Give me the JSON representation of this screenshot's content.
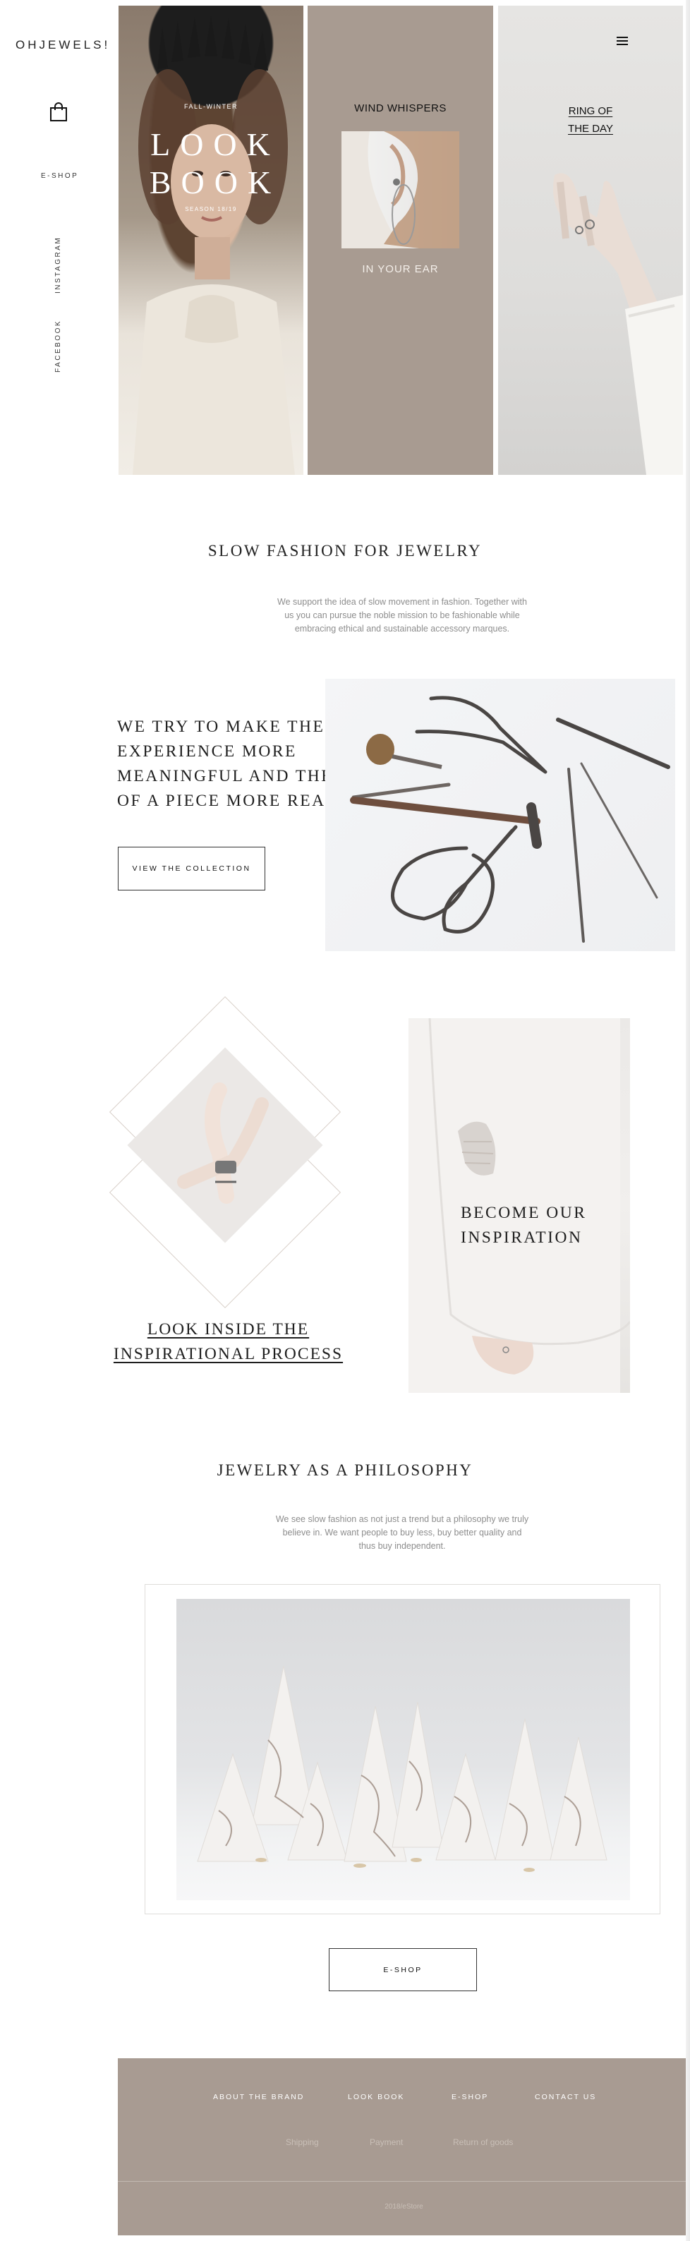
{
  "brand": {
    "logo": "OHJEWELS!"
  },
  "rail": {
    "shop": "E-SHOP",
    "instagram": "INSTAGRAM",
    "facebook": "FACEBOOK"
  },
  "hero": {
    "lookbook": {
      "season_top": "FALL-WINTER",
      "title_1": "LOOK",
      "title_2": "BOOK",
      "season_bottom": "SEASON 18/19"
    },
    "wind": {
      "title": "WIND WHISPERS",
      "subtitle": "IN YOUR EAR"
    },
    "ring": {
      "title_1": "RING OF",
      "title_2": "THE DAY"
    }
  },
  "slow": {
    "heading": "SLOW FASHION FOR JEWELRY",
    "para_1": "We support the idea of slow movement in fashion. Together with",
    "para_2": "us you can pursue the noble mission to be fashionable while",
    "para_3": "embracing ethical and sustainable accessory marques."
  },
  "experience": {
    "line_1": "WE TRY TO MAKE THE",
    "line_2": "EXPERIENCE MORE",
    "line_3": "MEANINGFUL AND THE STORY",
    "line_4": "OF A PIECE MORE REAL.",
    "button": "VIEW THE COLLECTION"
  },
  "inspiration": {
    "link_1": "LOOK INSIDE THE",
    "link_2": "INSPIRATIONAL PROCESS",
    "become_1": "BECOME OUR",
    "become_2": "INSPIRATION"
  },
  "philosophy": {
    "heading": "JEWELRY AS A PHILOSOPHY",
    "para_1": "We see slow fashion as not just a trend but a philosophy we truly",
    "para_2": "believe in. We want people to buy less, buy better quality and",
    "para_3": "thus buy independent.",
    "button": "E-SHOP"
  },
  "footer": {
    "links": [
      "ABOUT THE BRAND",
      "LOOK BOOK",
      "E-SHOP",
      "CONTACT US"
    ],
    "sub_links": [
      "Shipping",
      "Payment",
      "Return of goods"
    ],
    "copyright": "2018/eStore"
  },
  "colors": {
    "taupe": "#a89b92",
    "text": "#222222",
    "muted": "#8d8d8d"
  },
  "icons": [
    "shopping-bag-icon",
    "menu-icon"
  ]
}
